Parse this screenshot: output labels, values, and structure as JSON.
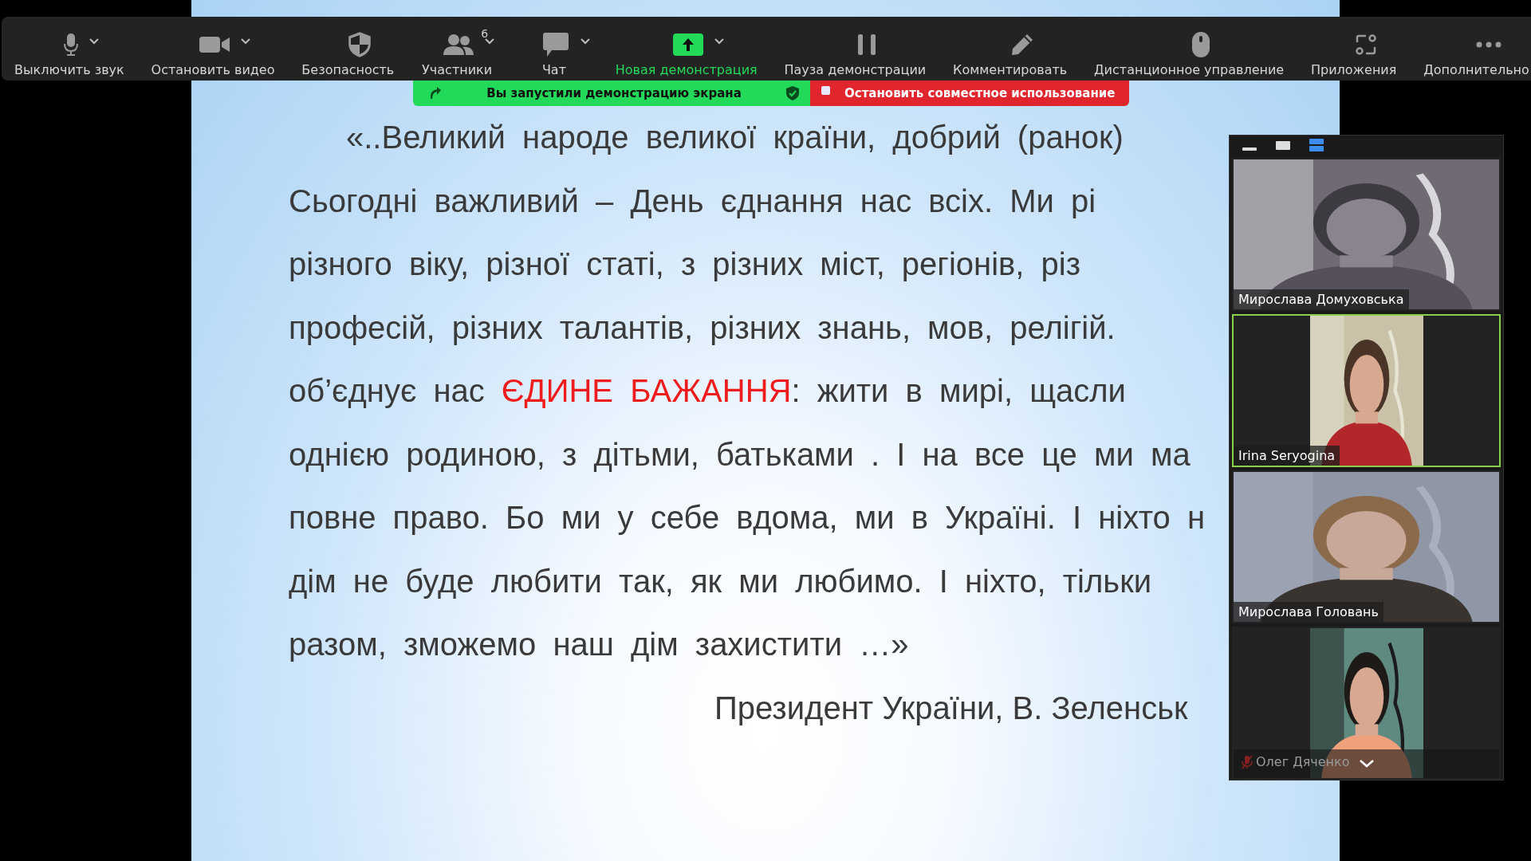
{
  "toolbar": {
    "items": [
      {
        "label": "Выключить звук",
        "has_menu": true,
        "highlighted": false
      },
      {
        "label": "Остановить видео",
        "has_menu": true,
        "highlighted": false
      },
      {
        "label": "Безопасность",
        "has_menu": false,
        "highlighted": false
      },
      {
        "label": "Участники",
        "badge": "6",
        "has_menu": true,
        "highlighted": false
      },
      {
        "label": "Чат",
        "has_menu": true,
        "highlighted": false
      },
      {
        "label": "Новая демонстрация",
        "has_menu": true,
        "highlighted": true
      },
      {
        "label": "Пауза демонстрации",
        "has_menu": false,
        "highlighted": false
      },
      {
        "label": "Комментировать",
        "has_menu": false,
        "highlighted": false
      },
      {
        "label": "Дистанционное управление",
        "has_menu": false,
        "highlighted": false
      },
      {
        "label": "Приложения",
        "has_menu": false,
        "highlighted": false
      },
      {
        "label": "Дополнительно",
        "has_menu": false,
        "highlighted": false
      }
    ]
  },
  "share_banner": {
    "status": "Вы запустили демонстрацию экрана",
    "stop_button": "Остановить совместное использование"
  },
  "slide": {
    "lines": [
      [
        {
          "text": "«..Великий народе великої країни, добрий (ранок)",
          "highlight": false
        }
      ],
      [
        {
          "text": "Сьогодні важливий – День єднання нас всіх. Ми рі",
          "highlight": false
        }
      ],
      [
        {
          "text": "різного віку, різної статі, з різних міст, регіонів, різ",
          "highlight": false
        }
      ],
      [
        {
          "text": "професій, різних талантів, різних знань, мов, релігій.",
          "highlight": false
        }
      ],
      [
        {
          "text": "об’єднує нас ",
          "highlight": false
        },
        {
          "text": "ЄДИНЕ БАЖАННЯ",
          "highlight": true
        },
        {
          "text": ": жити в мирі, щасли",
          "highlight": false
        }
      ],
      [
        {
          "text": "однією родиною, з дітьми, батьками . І на все це ми ма",
          "highlight": false
        }
      ],
      [
        {
          "text": "повне право. Бо ми у себе вдома, ми в Україні. І ніхто н",
          "highlight": false
        }
      ],
      [
        {
          "text": "дім не буде любити так, як ми любимо. І ніхто, тільки",
          "highlight": false
        }
      ],
      [
        {
          "text": "разом, зможемо наш дім захистити …»",
          "highlight": false
        }
      ]
    ],
    "signature": "Президент України, В. Зеленськ"
  },
  "participants": {
    "view_modes": [
      {
        "selected": false
      },
      {
        "selected": false
      },
      {
        "selected": true
      }
    ],
    "tiles": [
      {
        "name": "Мирослава Домуховська",
        "speaking": false,
        "muted": false,
        "kind": "wide"
      },
      {
        "name": "Irina Seryogina",
        "speaking": true,
        "muted": false,
        "kind": "portrait"
      },
      {
        "name": "Мирослава Головань",
        "speaking": false,
        "muted": false,
        "kind": "wide"
      },
      {
        "name": "Олег Дяченко",
        "speaking": false,
        "muted": true,
        "kind": "portrait"
      }
    ]
  }
}
